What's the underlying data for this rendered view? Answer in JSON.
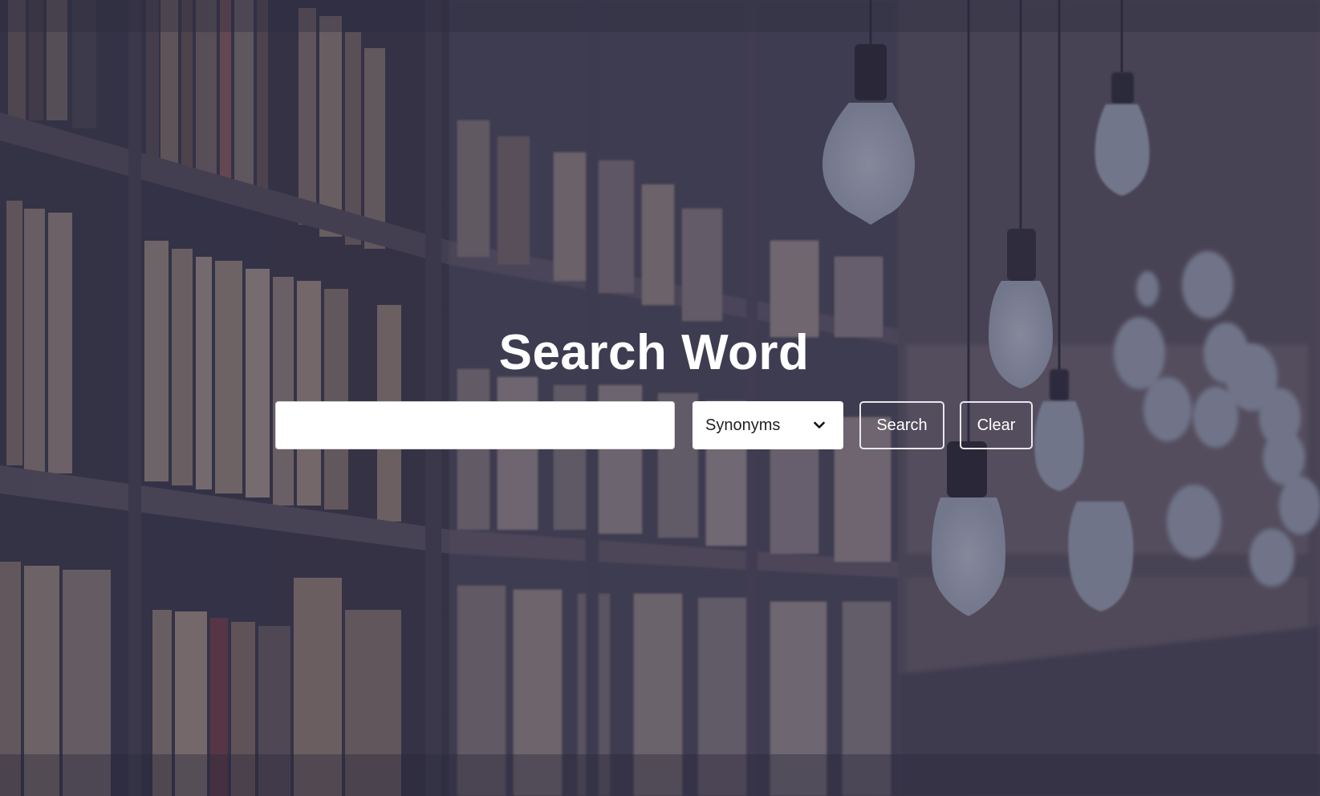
{
  "page": {
    "title": "Search Word"
  },
  "search": {
    "value": "",
    "placeholder": ""
  },
  "mode_select": {
    "selected": "Synonyms",
    "icon": "chevron-down-icon"
  },
  "buttons": {
    "search_label": "Search",
    "clear_label": "Clear"
  },
  "colors": {
    "overlay": "#282c46",
    "text": "#ffffff",
    "button_border": "#e8e8ee",
    "input_bg": "#ffffff"
  }
}
